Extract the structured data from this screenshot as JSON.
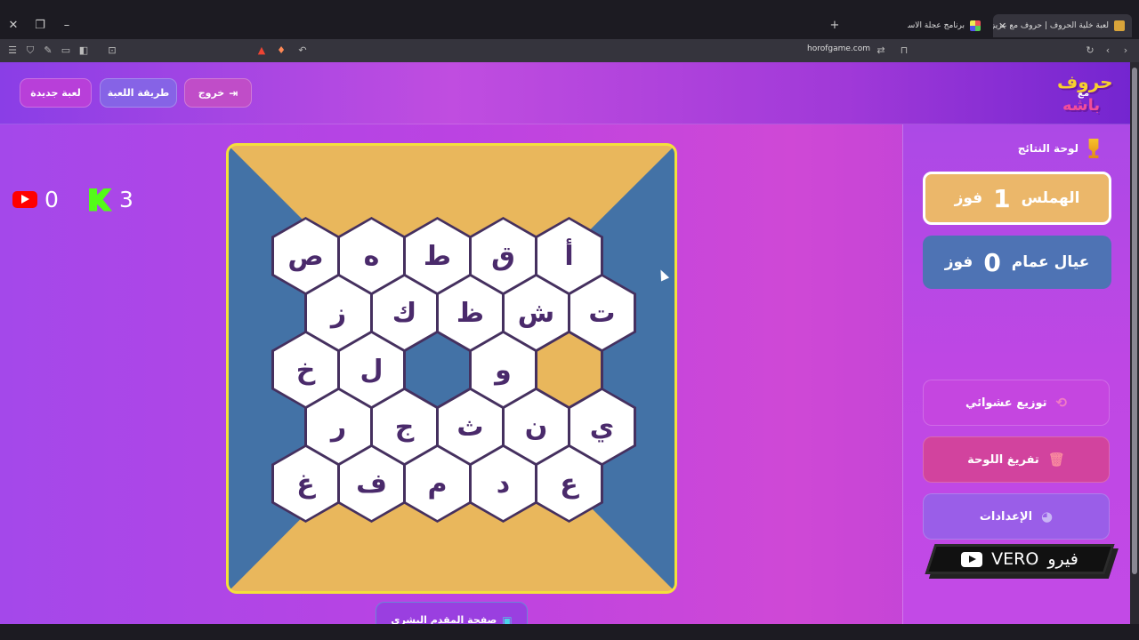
{
  "browser": {
    "tabs": [
      {
        "title": "لعبة خلية الحروف | حروف مع عزيز",
        "active": true
      },
      {
        "title": "برنامج عجلة الاسماء",
        "active": false
      }
    ],
    "url": "horofgame.com"
  },
  "header": {
    "buttons": {
      "new_game": "لعبة جديدة",
      "how_to_play": "طريقة اللعبة",
      "exit": "خروج"
    },
    "logo": {
      "line1": "حروف",
      "line2": "مع",
      "line3": "باشه"
    }
  },
  "counters": {
    "youtube": "0",
    "kick": "3"
  },
  "board": {
    "rows": [
      [
        "ص",
        "ه",
        "ط",
        "ق",
        "أ"
      ],
      [
        "ز",
        "ك",
        "ظ",
        "ش",
        "ت"
      ],
      [
        "خ",
        "ل",
        "",
        "و",
        ""
      ],
      [
        "ر",
        "ج",
        "ث",
        "ن",
        "ي"
      ],
      [
        "غ",
        "ف",
        "م",
        "د",
        "ع"
      ]
    ],
    "states": [
      [
        "white",
        "white",
        "white",
        "white",
        "white"
      ],
      [
        "white",
        "white",
        "white",
        "white",
        "white"
      ],
      [
        "white",
        "white",
        "blue",
        "white",
        "gold"
      ],
      [
        "white",
        "white",
        "white",
        "white",
        "white"
      ],
      [
        "white",
        "white",
        "white",
        "white",
        "white"
      ]
    ],
    "colors": {
      "gold": "#e9b75c",
      "blue": "#4372a6",
      "border": "#f4e03c"
    }
  },
  "presenter_button": "صفحة المقدم البشري",
  "sidebar": {
    "title": "لوحة النتائج",
    "teams": [
      {
        "name": "الهملس",
        "score": "1",
        "label": "فوز",
        "color": "#e9b75c"
      },
      {
        "name": "عيال عمام",
        "score": "0",
        "label": "فوز",
        "color": "#4e73b4"
      }
    ],
    "actions": {
      "shuffle": "توزيع عشوائي",
      "clear": "تفريغ اللوحة",
      "settings": "الإعدادات"
    },
    "overlay": {
      "arabic": "فيرو",
      "latin": "VERO"
    }
  }
}
